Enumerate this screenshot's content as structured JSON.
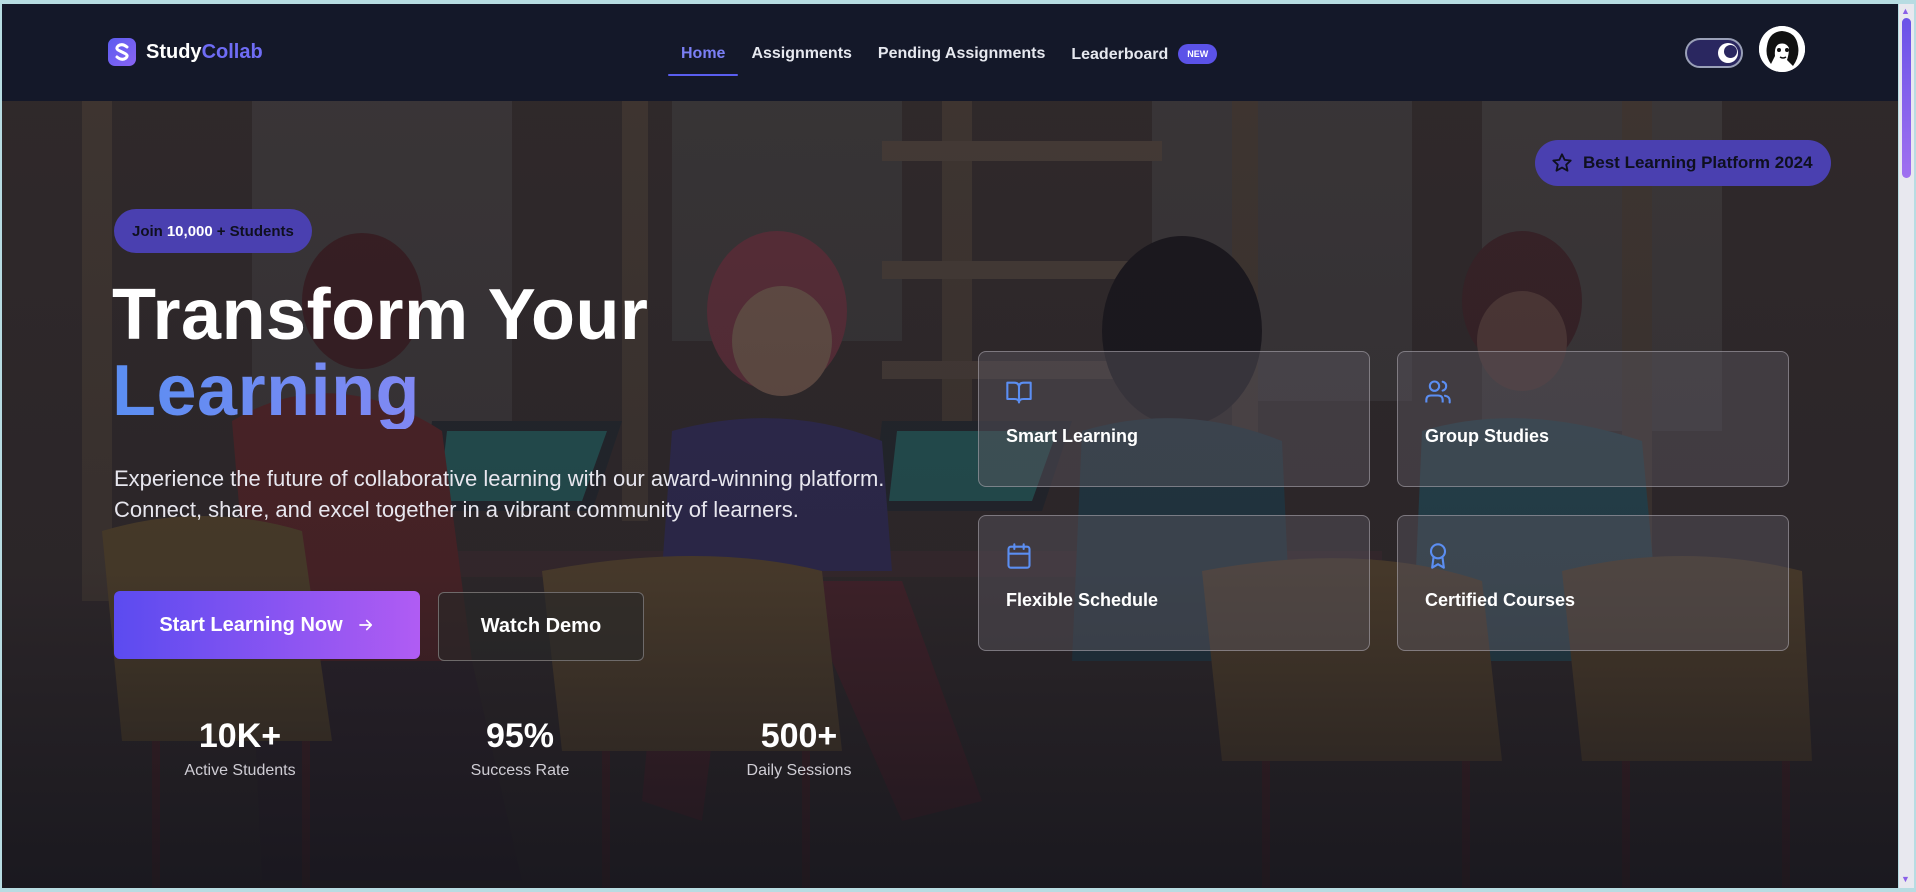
{
  "brand": {
    "name_part1": "Study",
    "name_part2": "Collab"
  },
  "nav": {
    "links": [
      {
        "label": "Home",
        "active": true
      },
      {
        "label": "Assignments"
      },
      {
        "label": "Pending Assignments"
      },
      {
        "label": "Leaderboard",
        "badge": "NEW"
      }
    ]
  },
  "header": {
    "theme_toggle": "dark",
    "avatar": "user-avatar"
  },
  "hero": {
    "award_label": "Best Learning Platform 2024",
    "join": {
      "prefix": "Join",
      "count": "10,000",
      "suffix": "+ Students"
    },
    "title_line1": "Transform Your",
    "title_line2": "Learning",
    "description": "Experience the future of collaborative learning with our award-winning platform. Connect, share, and excel together in a vibrant community of learners.",
    "primary_cta": "Start Learning Now",
    "secondary_cta": "Watch Demo",
    "stats": [
      {
        "value": "10K+",
        "label": "Active Students"
      },
      {
        "value": "95%",
        "label": "Success Rate"
      },
      {
        "value": "500+",
        "label": "Daily Sessions"
      }
    ],
    "features": [
      {
        "title": "Smart Learning",
        "icon": "book-icon"
      },
      {
        "title": "Group Studies",
        "icon": "users-icon"
      },
      {
        "title": "Flexible Schedule",
        "icon": "calendar-icon"
      },
      {
        "title": "Certified Courses",
        "icon": "award-icon"
      }
    ]
  },
  "colors": {
    "accent": "#5b5cf0",
    "nav_bg": "#141829",
    "icon_blue": "#5b8ef2"
  }
}
